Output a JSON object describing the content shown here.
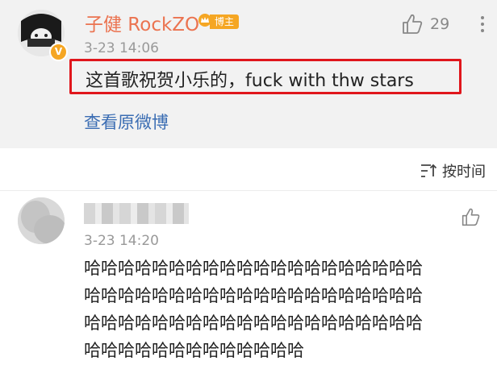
{
  "post": {
    "username": "子健 RockZO",
    "host_badge": "博主",
    "time": "3-23 14:06",
    "like_count": "29",
    "text": "这首歌祝贺小乐的，fuck with thw stars",
    "view_original": "查看原微博",
    "accent_color": "#eb7350",
    "highlight_color": "#e0161c"
  },
  "sort": {
    "label": "按时间"
  },
  "reply": {
    "time": "3-23 14:20",
    "lines": [
      "哈哈哈哈哈哈哈哈哈哈哈哈哈哈哈哈哈哈哈哈",
      "哈哈哈哈哈哈哈哈哈哈哈哈哈哈哈哈哈哈哈哈",
      "哈哈哈哈哈哈哈哈哈哈哈哈哈哈哈哈哈哈哈哈",
      "哈哈哈哈哈哈哈哈哈哈哈哈哈"
    ]
  },
  "icons": {
    "like": "thumbs-up-icon",
    "more": "more-vertical-icon",
    "sort": "sort-icon",
    "verified": "verified-badge-icon",
    "crown": "crown-icon"
  }
}
